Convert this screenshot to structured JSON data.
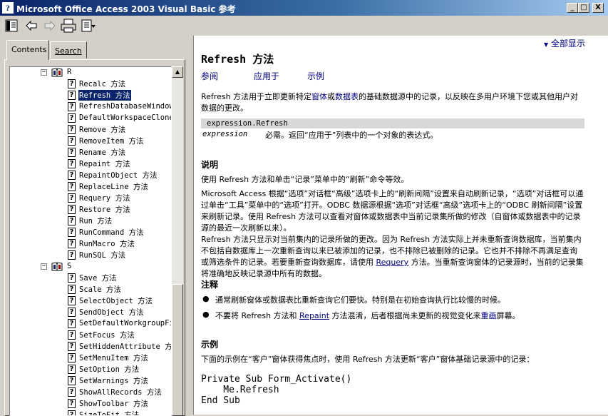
{
  "window": {
    "title": "Microsoft Office Access 2003 Visual Basic 参考",
    "icon_name": "help-question-icon",
    "min_glyph": "_",
    "max_glyph": "□",
    "close_glyph": "X"
  },
  "toolbar": {
    "buttons": [
      "hide-pane-icon",
      "back-icon",
      "forward-icon",
      "print-icon",
      "options-icon"
    ]
  },
  "tabs": {
    "contents": "Contents",
    "search": "Search"
  },
  "tree": {
    "group_r": "R",
    "items_r": [
      "Recalc 方法",
      "Refresh 方法",
      "RefreshDatabaseWindow",
      "DefaultWorkspaceClone",
      "Remove 方法",
      "RemoveItem 方法",
      "Rename 方法",
      "Repaint 方法",
      "RepaintObject 方法",
      "ReplaceLine 方法",
      "Requery 方法",
      "Restore 方法",
      "Run 方法",
      "RunCommand 方法",
      "RunMacro 方法",
      "RunSQL 方法"
    ],
    "group_s": "S",
    "items_s": [
      "Save 方法",
      "Scale 方法",
      "SelectObject 方法",
      "SendObject 方法",
      "SetDefaultWorkgroupFi",
      "SetFocus 方法",
      "SetHiddenAttribute 方",
      "SetMenuItem 方法",
      "SetOption 方法",
      "SetWarnings 方法",
      "ShowAllRecords 方法",
      "ShowToolbar 方法",
      "SizeToFit 方法"
    ],
    "selected": "Refresh 方法"
  },
  "content": {
    "show_all": "全部显示",
    "title": "Refresh 方法",
    "nav": {
      "see_also": "参阅",
      "applies_to": "应用于",
      "example": "示例"
    },
    "intro": {
      "a": "Refresh 方法用于立即更新特定",
      "link1": "窗体",
      "b": "或",
      "link2": "数据表",
      "c": "的基础数据源中的记录，以反映在多用户环境下您或其他用户对数据的更改。"
    },
    "syntax": "expression.Refresh",
    "param": {
      "name": "expression",
      "desc": "必需。返回“应用于”列表中的一个对象的表达式。"
    },
    "remarks_heading": "说明",
    "remark1": "使用 Refresh 方法和单击“记录”菜单中的“刷新”命令等效。",
    "remark2": "Microsoft Access 根据“选项”对话框“高级”选项卡上的“刷新间隔”设置来自动刷新记录，“选项”对话框可以通过单击“工具”菜单中的“选项”打开。ODBC 数据源根据“选项”对话框“高级”选项卡上的“ODBC 刷新间隔”设置来刷新记录。使用 Refresh 方法可以查看对窗体或数据表中当前记录集所做的修改（自窗体或数据表中的记录源的最近一次刷新以来）。",
    "remark3": {
      "a": "Refresh 方法只显示对当前集内的记录所做的更改。因为 Refresh 方法实际上并未重新查询数据库，当前集内不包括自数据库上一次重新查询以来已被添加的记录，也不排除已被删除的记录。它也并不排除不再满足查询或筛选条件的记录。若要重新查询数据库，请使用 ",
      "link": "Requery",
      "b": " 方法。当重新查询窗体的记录源时，当前的记录集将准确地反映记录源中所有的数据。"
    },
    "notes_heading": "注释",
    "bullet_glyph": "●",
    "note1": "通常刷新窗体或数据表比重新查询它们要快。特别是在初始查询执行比较慢的时候。",
    "note2": {
      "a": "不要将 Refresh 方法和 ",
      "link": "Repaint",
      "b": " 方法混淆，后者根据尚未更新的视觉变化来",
      "link2": "重画",
      "c": "屏幕。"
    },
    "example_heading": "示例",
    "example_intro": "下面的示例在“客户”窗体获得焦点时，使用 Refresh 方法更新“客户”窗体基础记录源中的记录：",
    "code": [
      "Private Sub Form_Activate()",
      "    Me.Refresh",
      "End Sub"
    ]
  }
}
